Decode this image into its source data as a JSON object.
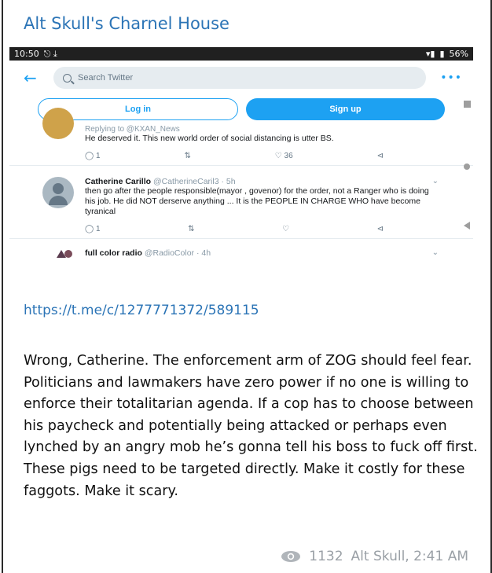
{
  "channel": {
    "title": "Alt Skull's Charnel House"
  },
  "screenshot": {
    "statusbar": {
      "time": "10:50",
      "left_icons": "⎋ ⤓",
      "battery": "56%"
    },
    "search": {
      "placeholder": "Search Twitter"
    },
    "auth": {
      "login_label": "Log in",
      "signup_label": "Sign up"
    },
    "tweets": [
      {
        "replying_to": "Replying to @KXAN_News",
        "text": "He deserved it. This new world order of social distancing is utter BS.",
        "actions": {
          "reply": "1",
          "retweet": "",
          "like": "36",
          "share": ""
        }
      },
      {
        "name": "Catherine Carillo",
        "handle": "@CatherineCaril3 · 5h",
        "text": "then go  after the  people responsible(mayor ,  govenor) for the order, not a Ranger  who  is doing his job.  He did NOT derserve  anything ... It is the PEOPLE IN CHARGE  WHO  have become tyranical",
        "actions": {
          "reply": "1",
          "retweet": "",
          "like": "",
          "share": ""
        }
      },
      {
        "name": "full color radio",
        "handle": "@RadioColor · 4h"
      }
    ]
  },
  "post": {
    "link": "https://t.me/c/1277771372/589115",
    "text": "Wrong, Catherine. The enforcement arm of ZOG should feel fear. Politicians and lawmakers have zero power if no one is willing to enforce their totalitarian agenda. If a cop has to choose between his paycheck and potentially being attacked or perhaps even lynched by an angry mob he’s gonna tell his boss to fuck off first. These pigs need to be targeted directly. Make it costly for these faggots. Make it scary.",
    "views": "1132",
    "author_time": "Alt Skull, 2:41 AM"
  },
  "colors": {
    "accent": "#2b74b6",
    "twitter_blue": "#1da1f2",
    "meta_gray": "#9aa0a6"
  }
}
